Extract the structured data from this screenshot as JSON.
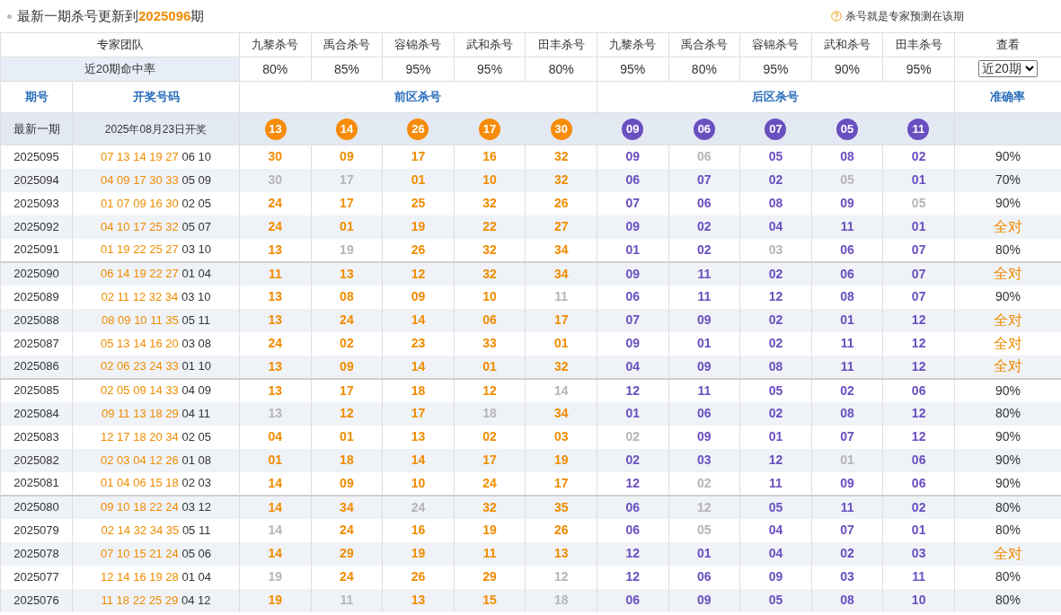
{
  "notice": {
    "prefix": "最新一期杀号更新到",
    "period": "2025096",
    "suffix": "期"
  },
  "hint": "杀号就是专家预测在该期",
  "experts": {
    "label": "专家团队",
    "names": [
      "九黎杀号",
      "禹合杀号",
      "容锦杀号",
      "武和杀号",
      "田丰杀号",
      "九黎杀号",
      "禹合杀号",
      "容锦杀号",
      "武和杀号",
      "田丰杀号"
    ],
    "view_label": "查看"
  },
  "rates": {
    "label": "近20期命中率",
    "values": [
      "80%",
      "85%",
      "95%",
      "95%",
      "80%",
      "95%",
      "80%",
      "95%",
      "90%",
      "95%"
    ],
    "select": "近20期"
  },
  "columns": {
    "period": "期号",
    "draw": "开奖号码",
    "front": "前区杀号",
    "back": "后区杀号",
    "accuracy": "准确率"
  },
  "latest": {
    "label": "最新一期",
    "date": "2025年08月23日开奖",
    "front": [
      "13",
      "14",
      "26",
      "17",
      "30"
    ],
    "back": [
      "09",
      "06",
      "07",
      "05",
      "11"
    ]
  },
  "rows": [
    {
      "period": "2025095",
      "draw_front": "07 13 14 19 27",
      "draw_back": "06 10",
      "front": [
        "30",
        "09",
        "17",
        "16",
        "32"
      ],
      "front_missed": [
        false,
        false,
        false,
        false,
        false
      ],
      "back": [
        "09",
        "06",
        "05",
        "08",
        "02"
      ],
      "back_missed": [
        false,
        true,
        false,
        false,
        false
      ],
      "accuracy": "90%",
      "perfect": false
    },
    {
      "period": "2025094",
      "draw_front": "04 09 17 30 33",
      "draw_back": "05 09",
      "front": [
        "30",
        "17",
        "01",
        "10",
        "32"
      ],
      "front_missed": [
        true,
        true,
        false,
        false,
        false
      ],
      "back": [
        "06",
        "07",
        "02",
        "05",
        "01"
      ],
      "back_missed": [
        false,
        false,
        false,
        true,
        false
      ],
      "accuracy": "70%",
      "perfect": false
    },
    {
      "period": "2025093",
      "draw_front": "01 07 09 16 30",
      "draw_back": "02 05",
      "front": [
        "24",
        "17",
        "25",
        "32",
        "26"
      ],
      "front_missed": [
        false,
        false,
        false,
        false,
        false
      ],
      "back": [
        "07",
        "06",
        "08",
        "09",
        "05"
      ],
      "back_missed": [
        false,
        false,
        false,
        false,
        true
      ],
      "accuracy": "90%",
      "perfect": false
    },
    {
      "period": "2025092",
      "draw_front": "04 10 17 25 32",
      "draw_back": "05 07",
      "front": [
        "24",
        "01",
        "19",
        "22",
        "27"
      ],
      "front_missed": [
        false,
        false,
        false,
        false,
        false
      ],
      "back": [
        "09",
        "02",
        "04",
        "11",
        "01"
      ],
      "back_missed": [
        false,
        false,
        false,
        false,
        false
      ],
      "accuracy": "全对",
      "perfect": true
    },
    {
      "period": "2025091",
      "draw_front": "01 19 22 25 27",
      "draw_back": "03 10",
      "front": [
        "13",
        "19",
        "26",
        "32",
        "34"
      ],
      "front_missed": [
        false,
        true,
        false,
        false,
        false
      ],
      "back": [
        "01",
        "02",
        "03",
        "06",
        "07"
      ],
      "back_missed": [
        false,
        false,
        true,
        false,
        false
      ],
      "accuracy": "80%",
      "perfect": false
    },
    {
      "period": "2025090",
      "draw_front": "06 14 19 22 27",
      "draw_back": "01 04",
      "front": [
        "11",
        "13",
        "12",
        "32",
        "34"
      ],
      "front_missed": [
        false,
        false,
        false,
        false,
        false
      ],
      "back": [
        "09",
        "11",
        "02",
        "06",
        "07"
      ],
      "back_missed": [
        false,
        false,
        false,
        false,
        false
      ],
      "accuracy": "全对",
      "perfect": true
    },
    {
      "period": "2025089",
      "draw_front": "02 11 12 32 34",
      "draw_back": "03 10",
      "front": [
        "13",
        "08",
        "09",
        "10",
        "11"
      ],
      "front_missed": [
        false,
        false,
        false,
        false,
        true
      ],
      "back": [
        "06",
        "11",
        "12",
        "08",
        "07"
      ],
      "back_missed": [
        false,
        false,
        false,
        false,
        false
      ],
      "accuracy": "90%",
      "perfect": false
    },
    {
      "period": "2025088",
      "draw_front": "08 09 10 11 35",
      "draw_back": "05 11",
      "front": [
        "13",
        "24",
        "14",
        "06",
        "17"
      ],
      "front_missed": [
        false,
        false,
        false,
        false,
        false
      ],
      "back": [
        "07",
        "09",
        "02",
        "01",
        "12"
      ],
      "back_missed": [
        false,
        false,
        false,
        false,
        false
      ],
      "accuracy": "全对",
      "perfect": true
    },
    {
      "period": "2025087",
      "draw_front": "05 13 14 16 20",
      "draw_back": "03 08",
      "front": [
        "24",
        "02",
        "23",
        "33",
        "01"
      ],
      "front_missed": [
        false,
        false,
        false,
        false,
        false
      ],
      "back": [
        "09",
        "01",
        "02",
        "11",
        "12"
      ],
      "back_missed": [
        false,
        false,
        false,
        false,
        false
      ],
      "accuracy": "全对",
      "perfect": true
    },
    {
      "period": "2025086",
      "draw_front": "02 06 23 24 33",
      "draw_back": "01 10",
      "front": [
        "13",
        "09",
        "14",
        "01",
        "32"
      ],
      "front_missed": [
        false,
        false,
        false,
        false,
        false
      ],
      "back": [
        "04",
        "09",
        "08",
        "11",
        "12"
      ],
      "back_missed": [
        false,
        false,
        false,
        false,
        false
      ],
      "accuracy": "全对",
      "perfect": true
    },
    {
      "period": "2025085",
      "draw_front": "02 05 09 14 33",
      "draw_back": "04 09",
      "front": [
        "13",
        "17",
        "18",
        "12",
        "14"
      ],
      "front_missed": [
        false,
        false,
        false,
        false,
        true
      ],
      "back": [
        "12",
        "11",
        "05",
        "02",
        "06"
      ],
      "back_missed": [
        false,
        false,
        false,
        false,
        false
      ],
      "accuracy": "90%",
      "perfect": false
    },
    {
      "period": "2025084",
      "draw_front": "09 11 13 18 29",
      "draw_back": "04 11",
      "front": [
        "13",
        "12",
        "17",
        "18",
        "34"
      ],
      "front_missed": [
        true,
        false,
        false,
        true,
        false
      ],
      "back": [
        "01",
        "06",
        "02",
        "08",
        "12"
      ],
      "back_missed": [
        false,
        false,
        false,
        false,
        false
      ],
      "accuracy": "80%",
      "perfect": false
    },
    {
      "period": "2025083",
      "draw_front": "12 17 18 20 34",
      "draw_back": "02 05",
      "front": [
        "04",
        "01",
        "13",
        "02",
        "03"
      ],
      "front_missed": [
        false,
        false,
        false,
        false,
        false
      ],
      "back": [
        "02",
        "09",
        "01",
        "07",
        "12"
      ],
      "back_missed": [
        true,
        false,
        false,
        false,
        false
      ],
      "accuracy": "90%",
      "perfect": false
    },
    {
      "period": "2025082",
      "draw_front": "02 03 04 12 26",
      "draw_back": "01 08",
      "front": [
        "01",
        "18",
        "14",
        "17",
        "19"
      ],
      "front_missed": [
        false,
        false,
        false,
        false,
        false
      ],
      "back": [
        "02",
        "03",
        "12",
        "01",
        "06"
      ],
      "back_missed": [
        false,
        false,
        false,
        true,
        false
      ],
      "accuracy": "90%",
      "perfect": false
    },
    {
      "period": "2025081",
      "draw_front": "01 04 06 15 18",
      "draw_back": "02 03",
      "front": [
        "14",
        "09",
        "10",
        "24",
        "17"
      ],
      "front_missed": [
        false,
        false,
        false,
        false,
        false
      ],
      "back": [
        "12",
        "02",
        "11",
        "09",
        "06"
      ],
      "back_missed": [
        false,
        true,
        false,
        false,
        false
      ],
      "accuracy": "90%",
      "perfect": false
    },
    {
      "period": "2025080",
      "draw_front": "09 10 18 22 24",
      "draw_back": "03 12",
      "front": [
        "14",
        "34",
        "24",
        "32",
        "35"
      ],
      "front_missed": [
        false,
        false,
        true,
        false,
        false
      ],
      "back": [
        "06",
        "12",
        "05",
        "11",
        "02"
      ],
      "back_missed": [
        false,
        true,
        false,
        false,
        false
      ],
      "accuracy": "80%",
      "perfect": false
    },
    {
      "period": "2025079",
      "draw_front": "02 14 32 34 35",
      "draw_back": "05 11",
      "front": [
        "14",
        "24",
        "16",
        "19",
        "26"
      ],
      "front_missed": [
        true,
        false,
        false,
        false,
        false
      ],
      "back": [
        "06",
        "05",
        "04",
        "07",
        "01"
      ],
      "back_missed": [
        false,
        true,
        false,
        false,
        false
      ],
      "accuracy": "80%",
      "perfect": false
    },
    {
      "period": "2025078",
      "draw_front": "07 10 15 21 24",
      "draw_back": "05 06",
      "front": [
        "14",
        "29",
        "19",
        "11",
        "13"
      ],
      "front_missed": [
        false,
        false,
        false,
        false,
        false
      ],
      "back": [
        "12",
        "01",
        "04",
        "02",
        "03"
      ],
      "back_missed": [
        false,
        false,
        false,
        false,
        false
      ],
      "accuracy": "全对",
      "perfect": true
    },
    {
      "period": "2025077",
      "draw_front": "12 14 16 19 28",
      "draw_back": "01 04",
      "front": [
        "19",
        "24",
        "26",
        "29",
        "12"
      ],
      "front_missed": [
        true,
        false,
        false,
        false,
        true
      ],
      "back": [
        "12",
        "06",
        "09",
        "03",
        "11"
      ],
      "back_missed": [
        false,
        false,
        false,
        false,
        false
      ],
      "accuracy": "80%",
      "perfect": false
    },
    {
      "period": "2025076",
      "draw_front": "11 18 22 25 29",
      "draw_back": "04 12",
      "front": [
        "19",
        "11",
        "13",
        "15",
        "18"
      ],
      "front_missed": [
        false,
        true,
        false,
        false,
        true
      ],
      "back": [
        "06",
        "09",
        "05",
        "08",
        "10"
      ],
      "back_missed": [
        false,
        false,
        false,
        false,
        false
      ],
      "accuracy": "80%",
      "perfect": false
    }
  ]
}
